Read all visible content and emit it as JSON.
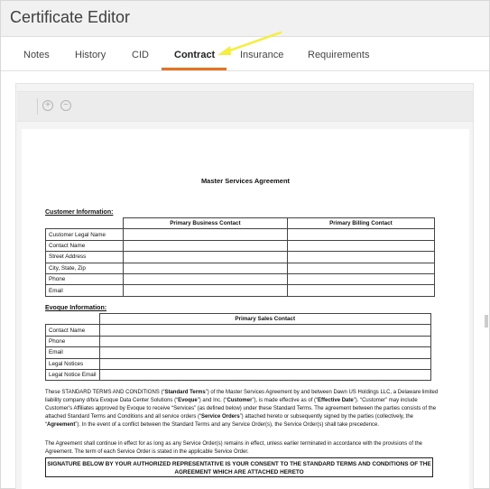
{
  "window": {
    "title": "Certificate Editor"
  },
  "tabs": [
    {
      "label": "Notes"
    },
    {
      "label": "History"
    },
    {
      "label": "CID"
    },
    {
      "label": "Contract",
      "active": true
    },
    {
      "label": "Insurance"
    },
    {
      "label": "Requirements"
    }
  ],
  "toolbar": {
    "zoom_in_icon": "plus-circle-icon",
    "zoom_out_icon": "minus-circle-icon"
  },
  "colors": {
    "accent": "#e8731f",
    "annotation_arrow": "#f5ee3b"
  },
  "document": {
    "title": "Master Services Agreement",
    "customer_section": {
      "label": "Customer Information:",
      "col_headers": [
        "Primary Business Contact",
        "Primary Billing Contact"
      ],
      "rows": [
        "Customer Legal Name",
        "Contact Name",
        "Street Address",
        "City, State, Zip",
        "Phone",
        "Email"
      ]
    },
    "evoque_section": {
      "label": "Evoque Information:",
      "col_header": "Primary Sales Contact",
      "rows": [
        "Contact Name",
        "Phone",
        "Email",
        "Legal Notices",
        "Legal Notice Email"
      ]
    },
    "para1": {
      "t1": "These STANDARD TERMS AND CONDITIONS (“",
      "b1": "Standard Terms",
      "t2": "”) of the Master Services Agreement by and between Dawn US Holdings LLC, a Delaware limited liability company d/b/a Evoque Data Center Solutions (“",
      "b2": "Evoque",
      "t3": "”) and Inc. (“",
      "b3": "Customer",
      "t4": "”), is made effective as of                     (“",
      "b4": "Effective Date",
      "t5": "”). “Customer” may include Customer's Affiliates approved by Evoque to receive “Services” (as defined below) under these Standard Terms. The agreement between the parties consists of the attached Standard Terms and Conditions and all service orders (“",
      "b5": "Service Orders",
      "t6": "”) attached hereto or subsequently signed by the parties (collectively, the “",
      "b6": "Agreement",
      "t7": "”). In the event of a conflict between the Standard Terms and any Service Order(s), the Service Order(s) shall take precedence."
    },
    "para2": "The Agreement shall continue in effect for as long as any Service Order(s) remains in effect, unless earlier terminated in accordance with the provisions of the Agreement. The term of each Service Order is stated in the applicable Service Order.",
    "signature_notice": "SIGNATURE BELOW BY YOUR AUTHORIZED REPRESENTATIVE IS YOUR CONSENT TO THE STANDARD TERMS AND CONDITIONS OF THE AGREEMENT WHICH ARE ATTACHED HERETO"
  }
}
